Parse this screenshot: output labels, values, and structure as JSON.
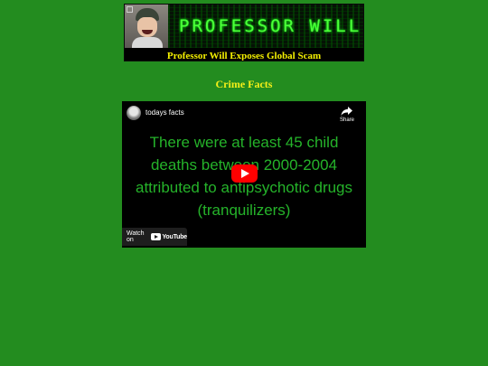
{
  "banner": {
    "title": "PROFESSOR WILL",
    "subtitle": "Professor Will Exposes Global Scam"
  },
  "section": {
    "heading": "Crime Facts"
  },
  "video": {
    "channel": "todays facts",
    "share_label": "Share",
    "caption": "There were at least 45 child deaths between 2000-2004 attributed to antipsychotic drugs (tranquilizers)",
    "watch_on_label": "Watch on",
    "youtube_word": "YouTube",
    "caption_color": "#25b32a",
    "play_color": "#ff0000"
  },
  "colors": {
    "page_background": "#238c1f",
    "heading": "#f4ef18",
    "banner_title": "#4dff3a",
    "banner_subtitle": "#f4f000"
  },
  "icons": {
    "share": "share-arrow-icon",
    "play": "play-icon",
    "youtube": "youtube-logo-icon"
  }
}
